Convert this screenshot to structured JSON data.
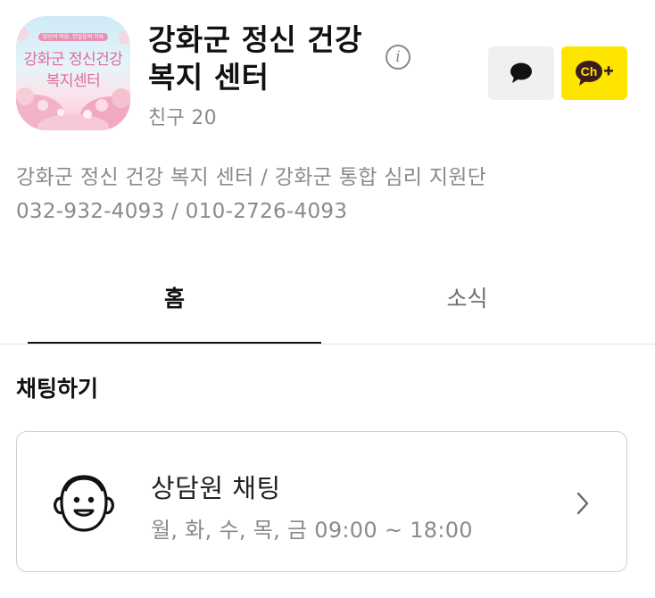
{
  "channel": {
    "name": "강화군 정신 건강 복지 센터",
    "friends_label": "친구 20",
    "profile_image": {
      "small_label": "당신의 마음, 한걸음씩 가요",
      "text_line1": "강화군 정신건강",
      "text_line2": "복지센터"
    }
  },
  "actions": {
    "chat_icon": "chat-bubble-icon",
    "add_channel_icon": "channel-add-icon",
    "add_channel_label": "Ch"
  },
  "info": {
    "description": "강화군 정신 건강 복지 센터 / 강화군 통합 심리 지원단",
    "phones": "032-932-4093 / 010-2726-4093"
  },
  "tabs": [
    {
      "label": "홈",
      "active": true
    },
    {
      "label": "소식",
      "active": false
    }
  ],
  "chat_section": {
    "title": "채팅하기",
    "card": {
      "title": "상담원 채팅",
      "hours": "월, 화, 수, 목, 금 09:00 ~ 18:00",
      "icon": "counselor-face-icon"
    }
  },
  "colors": {
    "kakao_yellow": "#fee500",
    "text_primary": "#111111",
    "text_secondary": "#8a8a8a"
  }
}
